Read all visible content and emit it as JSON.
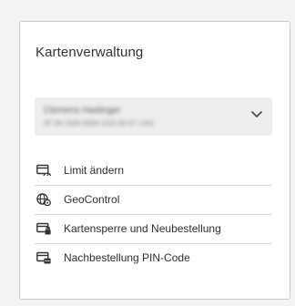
{
  "card": {
    "title": "Kartenverwaltung"
  },
  "account_select": {
    "line1": "Clemens Haslinger",
    "line2": "AT 94 1500 0004 1110 63 07 | 001"
  },
  "menu": {
    "items": [
      {
        "label": "Limit ändern",
        "icon": "card-gauge-icon"
      },
      {
        "label": "GeoControl",
        "icon": "globe-settings-icon"
      },
      {
        "label": "Kartensperre und Neubestellung",
        "icon": "card-lock-icon"
      },
      {
        "label": "Nachbestellung PIN-Code",
        "icon": "card-pin-icon"
      }
    ]
  },
  "colors": {
    "icon": "#333333",
    "divider": "#d9d9d9",
    "select_bg": "#eeeeee"
  }
}
